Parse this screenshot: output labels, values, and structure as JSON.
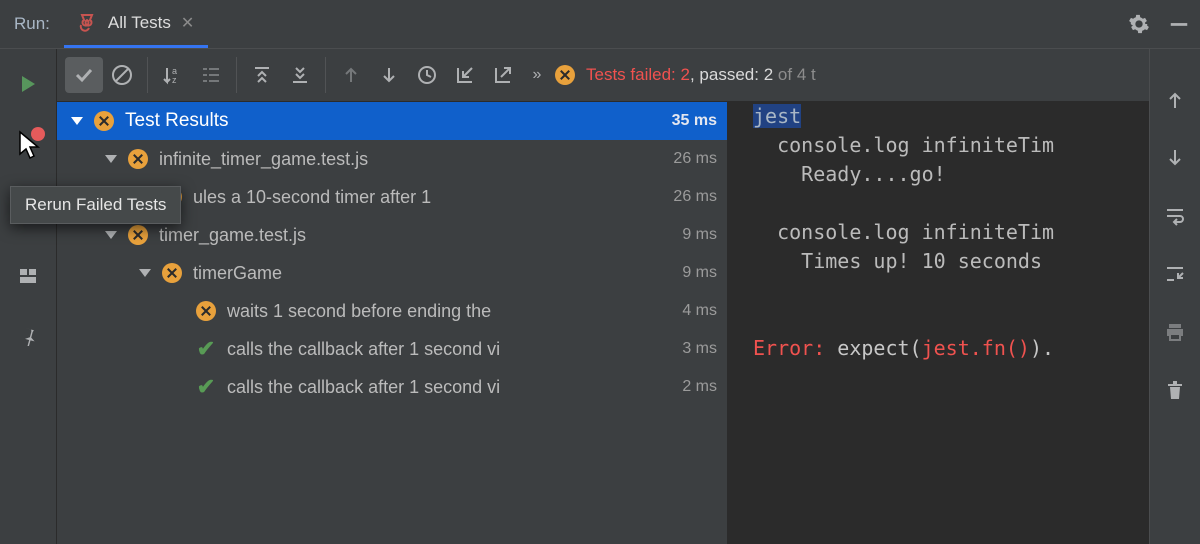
{
  "header": {
    "run_label": "Run:",
    "tab_title": "All Tests"
  },
  "tooltip": "Rerun Failed Tests",
  "status": {
    "failed_label": "Tests failed:",
    "failed_count": "2",
    "passed_label": ", passed:",
    "passed_count": "2",
    "of": "of",
    "total": "4 t"
  },
  "tree": {
    "root": {
      "label": "Test Results",
      "duration": "35 ms"
    },
    "nodes": [
      {
        "indent": 1,
        "status": "fail",
        "label": "infinite_timer_game.test.js",
        "duration": "26 ms",
        "expanded": true
      },
      {
        "indent": 2,
        "status": "fail",
        "label": "ules a 10-second timer after 1",
        "duration": "26 ms",
        "expanded": false
      },
      {
        "indent": 1,
        "status": "fail",
        "label": "timer_game.test.js",
        "duration": "9 ms",
        "expanded": true
      },
      {
        "indent": 2,
        "status": "fail",
        "label": "timerGame",
        "duration": "9 ms",
        "expanded": true
      },
      {
        "indent": 3,
        "status": "fail",
        "label": "waits 1 second before ending the",
        "duration": "4 ms",
        "expanded": false
      },
      {
        "indent": 3,
        "status": "pass",
        "label": "calls the callback after 1 second vi",
        "duration": "3 ms",
        "expanded": false
      },
      {
        "indent": 3,
        "status": "pass",
        "label": "calls the callback after 1 second vi",
        "duration": "2 ms",
        "expanded": false
      }
    ]
  },
  "output": {
    "hl": "jest",
    "lines": [
      "  console.log infiniteTim",
      "    Ready....go!",
      "",
      "  console.log infiniteTim",
      "    Times up! 10 seconds ",
      "",
      ""
    ],
    "error_prefix": "Error: ",
    "error_white": "expect(",
    "error_red": "jest.fn()",
    "error_tail": ")."
  }
}
